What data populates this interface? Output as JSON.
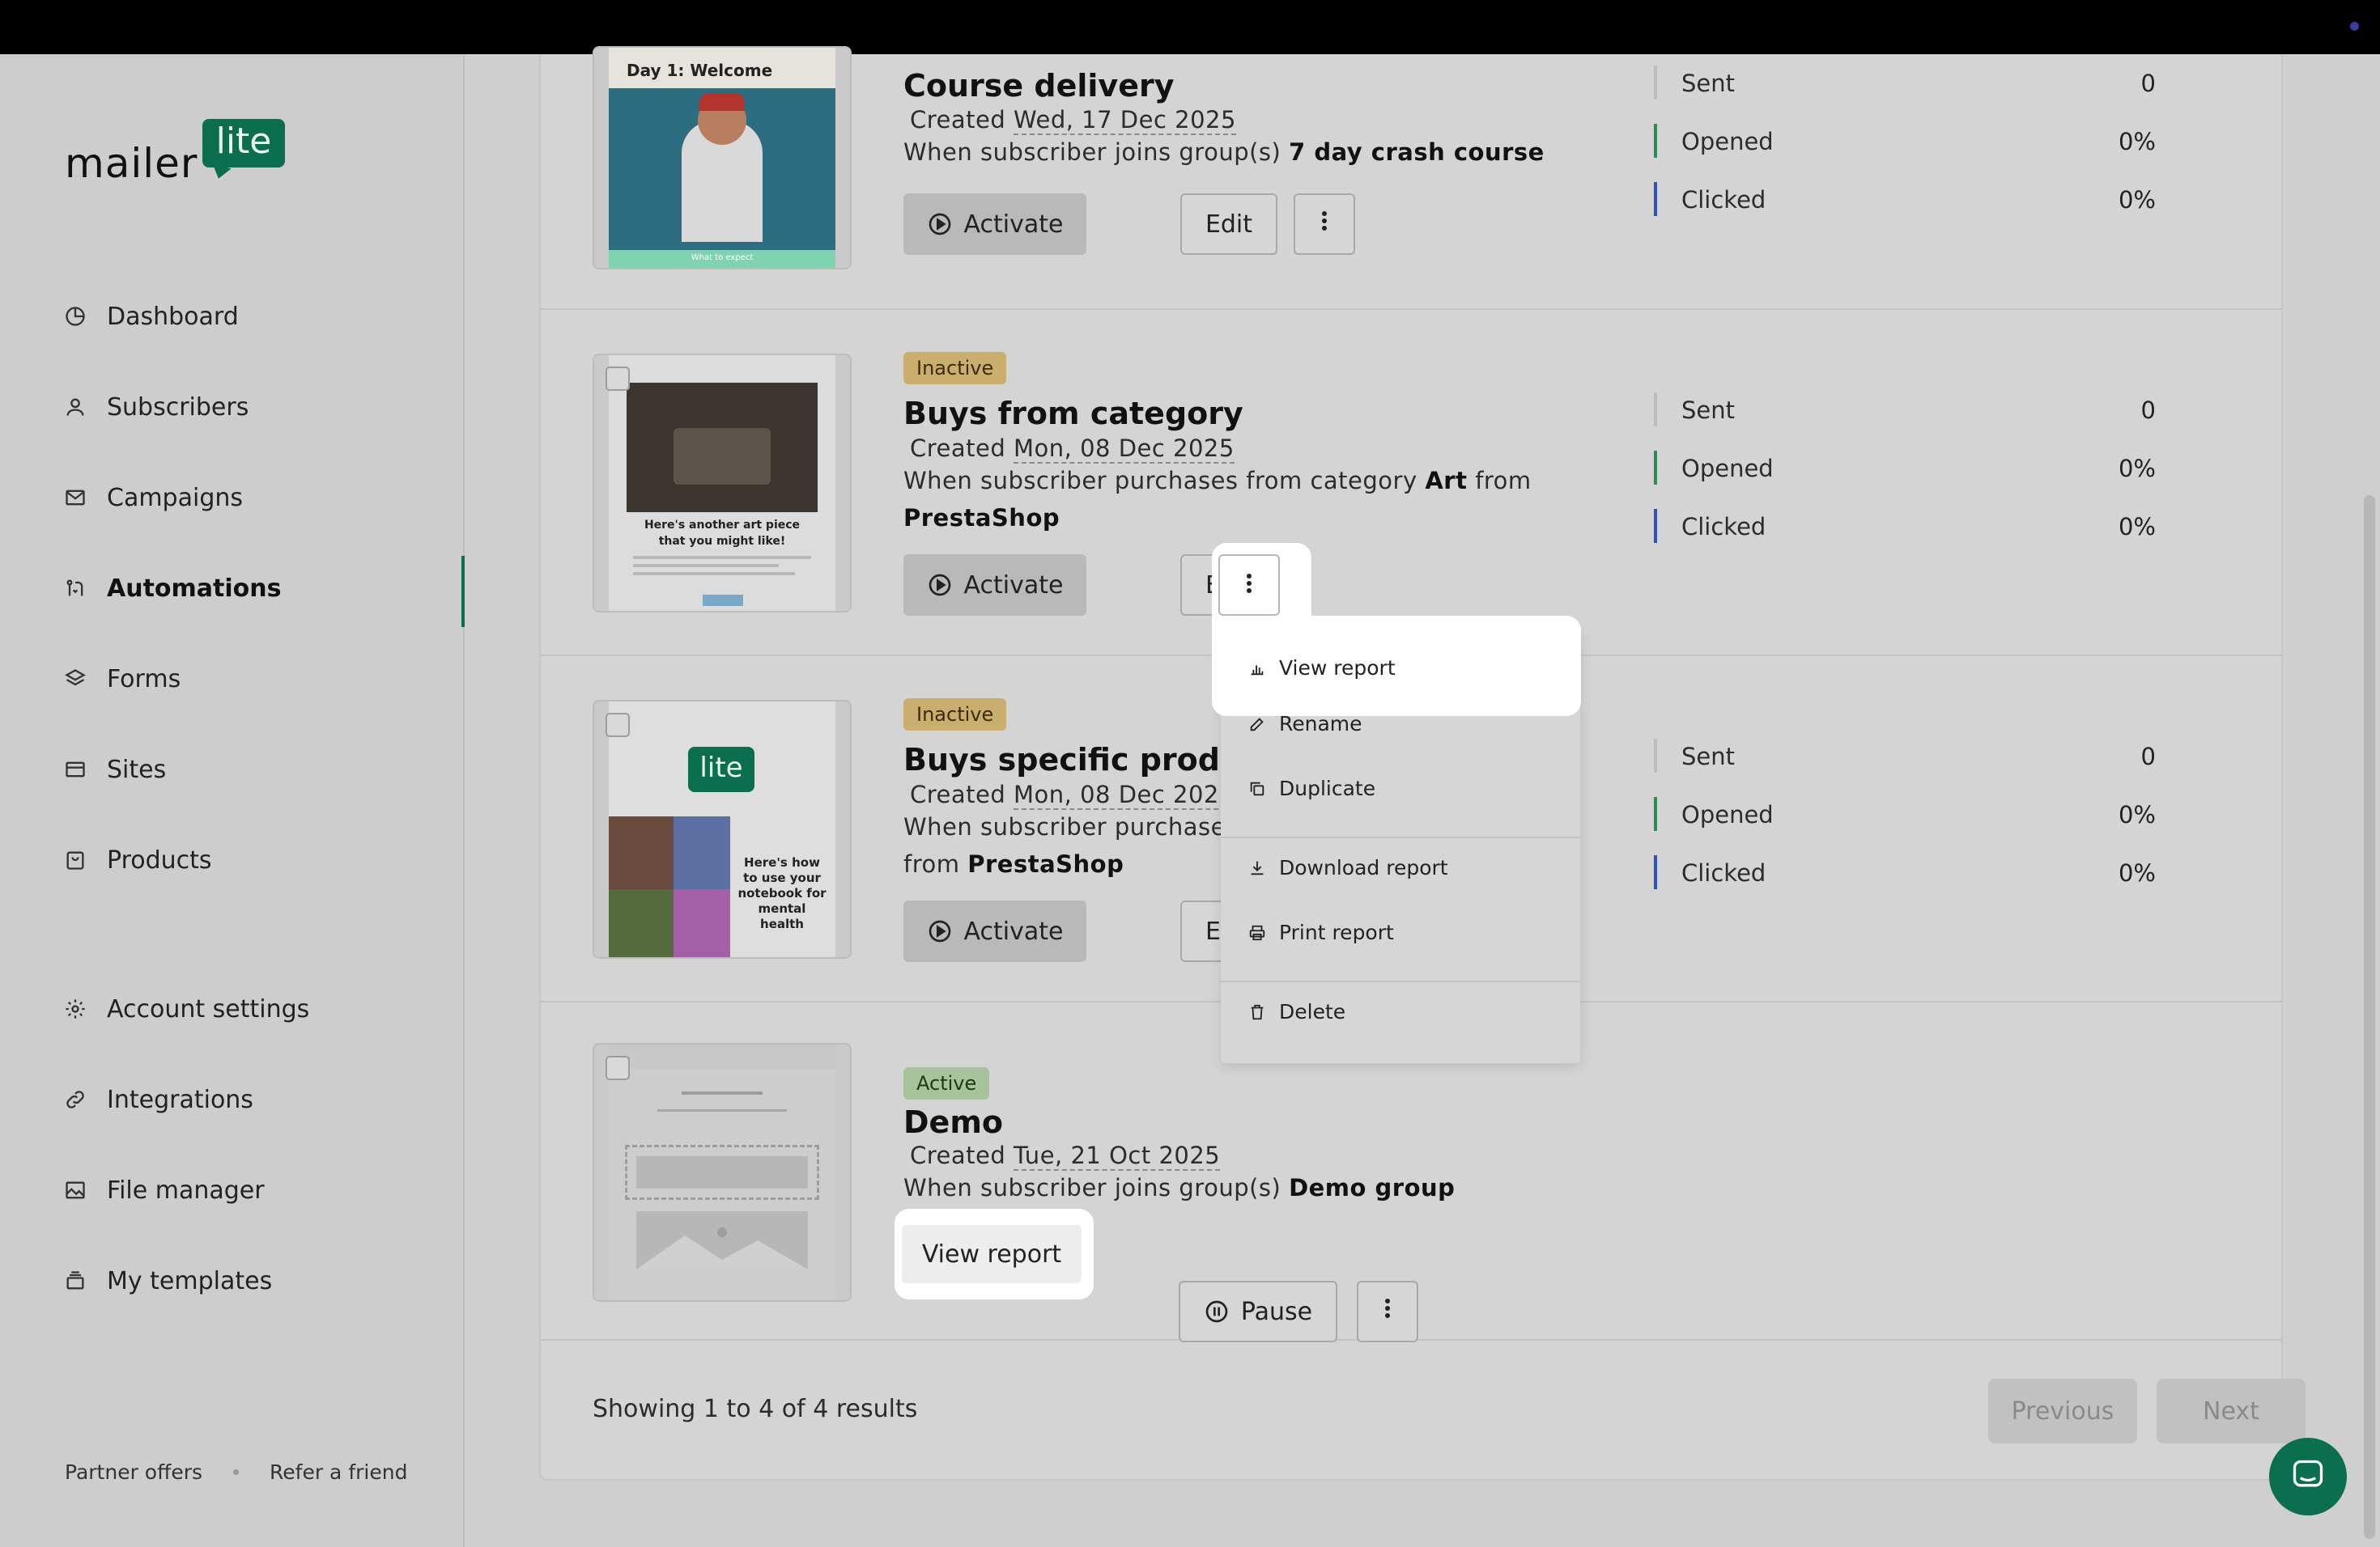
{
  "brand": {
    "word": "mailer",
    "lite": "lite",
    "accent": "#0b6e4f"
  },
  "sidebar": {
    "items": [
      {
        "label": "Dashboard",
        "icon": "clock-pie-icon"
      },
      {
        "label": "Subscribers",
        "icon": "person-icon"
      },
      {
        "label": "Campaigns",
        "icon": "envelope-icon"
      },
      {
        "label": "Automations",
        "icon": "automation-icon",
        "active": true
      },
      {
        "label": "Forms",
        "icon": "layers-icon"
      },
      {
        "label": "Sites",
        "icon": "browser-icon"
      },
      {
        "label": "Products",
        "icon": "bag-icon"
      },
      {
        "label": "Account settings",
        "icon": "gear-icon"
      },
      {
        "label": "Integrations",
        "icon": "link-icon"
      },
      {
        "label": "File manager",
        "icon": "image-icon"
      },
      {
        "label": "My templates",
        "icon": "stack-icon"
      }
    ],
    "footer": {
      "partner": "Partner offers",
      "refer": "Refer a friend"
    }
  },
  "stat_labels": {
    "sent": "Sent",
    "opened": "Opened",
    "clicked": "Clicked"
  },
  "automations": [
    {
      "status": "",
      "title": "Course delivery",
      "created_prefix": "Created",
      "created_date": "Wed, 17 Dec 2025",
      "when_text": "When subscriber joins group(s)",
      "when_bold": "7 day crash course",
      "thumb_text": "Day 1: Welcome",
      "thumb_footer": "What to expect",
      "buttons": {
        "primary": "Activate",
        "edit": "Edit"
      },
      "stats": {
        "sent": "0",
        "opened": "0%",
        "clicked": "0%"
      }
    },
    {
      "status": "Inactive",
      "title": "Buys from category",
      "created_prefix": "Created",
      "created_date": "Mon, 08 Dec 2025",
      "when_text": "When subscriber purchases from category",
      "when_bold": "Art",
      "when_mid": "from",
      "when_bold2": "PrestaShop",
      "thumb_text": "Here's another art piece that you might like!",
      "buttons": {
        "primary": "Activate",
        "edit": "Edit"
      },
      "stats": {
        "sent": "0",
        "opened": "0%",
        "clicked": "0%"
      }
    },
    {
      "status": "Inactive",
      "title": "Buys specific product",
      "created_prefix": "Created",
      "created_date": "Mon, 08 Dec 2025",
      "when_text": "When subscriber purchases",
      "when_mid": "from",
      "when_bold2": "PrestaShop",
      "thumb_logo": "lite",
      "thumb_text": "Here's how to use your notebook for mental health",
      "buttons": {
        "primary": "Activate",
        "edit": "Edit"
      },
      "stats": {
        "sent": "0",
        "opened": "0%",
        "clicked": "0%"
      }
    },
    {
      "status": "Active",
      "title": "Demo",
      "created_prefix": "Created",
      "created_date": "Tue, 21 Oct 2025",
      "when_text": "When subscriber joins group(s)",
      "when_bold": "Demo group",
      "buttons": {
        "primary": "View report",
        "pause": "Pause"
      }
    }
  ],
  "dropdown": {
    "items": [
      {
        "label": "View report",
        "icon": "bar-chart-icon"
      },
      {
        "label": "Rename",
        "icon": "pencil-icon"
      },
      {
        "label": "Duplicate",
        "icon": "copy-icon"
      },
      {
        "label": "Download report",
        "icon": "download-icon"
      },
      {
        "label": "Print report",
        "icon": "printer-icon"
      },
      {
        "label": "Delete",
        "icon": "trash-icon"
      }
    ]
  },
  "pagination": {
    "showing": "Showing 1 to 4 of 4 results",
    "previous": "Previous",
    "next": "Next"
  }
}
